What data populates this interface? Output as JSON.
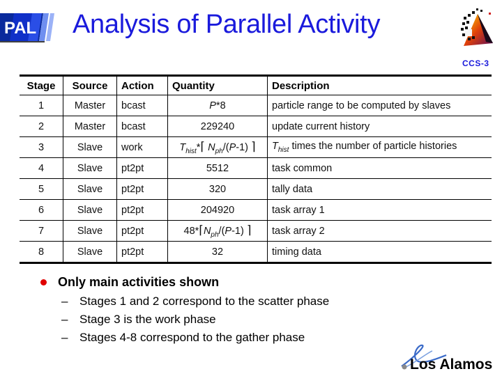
{
  "header": {
    "logo_text": "PAL",
    "title": "Analysis of Parallel Activity",
    "corner_label": "CCS-3"
  },
  "table": {
    "columns": [
      "Stage",
      "Source",
      "Action",
      "Quantity",
      "Description"
    ],
    "rows": [
      {
        "stage": "1",
        "source": "Master",
        "action": "bcast",
        "quantity": "P*8",
        "description": "particle range to be computed by slaves"
      },
      {
        "stage": "2",
        "source": "Master",
        "action": "bcast",
        "quantity": "229240",
        "description": "update current history"
      },
      {
        "stage": "3",
        "source": "Slave",
        "action": "work",
        "quantity": "Thist*⌈Nph/(P-1)⌉",
        "description": "Thist times the number of particle histories"
      },
      {
        "stage": "4",
        "source": "Slave",
        "action": "pt2pt",
        "quantity": "5512",
        "description": "task common"
      },
      {
        "stage": "5",
        "source": "Slave",
        "action": "pt2pt",
        "quantity": "320",
        "description": "tally data"
      },
      {
        "stage": "6",
        "source": "Slave",
        "action": "pt2pt",
        "quantity": "204920",
        "description": "task array 1"
      },
      {
        "stage": "7",
        "source": "Slave",
        "action": "pt2pt",
        "quantity": "48*⌈Nph/(P-1)⌉",
        "description": "task array 2"
      },
      {
        "stage": "8",
        "source": "Slave",
        "action": "pt2pt",
        "quantity": "32",
        "description": "timing data"
      }
    ],
    "formula_parts": {
      "P": "P",
      "times8": "*8",
      "T": "T",
      "hist": "hist",
      "star": "*",
      "lceil": "⌈",
      "N": "N",
      "ph": "ph",
      "slash_open": "/(",
      "P_minus": "P",
      "minus1": "-1)",
      "rceil": "⌉",
      "forty_eight": "48*",
      "desc3_rest": " times the number of particle histories"
    }
  },
  "bullets": {
    "main": "Only main activities shown",
    "sub": [
      "Stages 1 and 2 correspond to the scatter phase",
      "Stage 3 is the work phase",
      "Stages 4-8 correspond to the gather phase"
    ],
    "dash": "–"
  },
  "footer": {
    "logo_text": "Los Alamos"
  },
  "colors": {
    "title": "#1a1adc",
    "bullet": "#e00000",
    "pal_dark": "#0a2a9c",
    "pal_light": "#6f8ff0"
  }
}
